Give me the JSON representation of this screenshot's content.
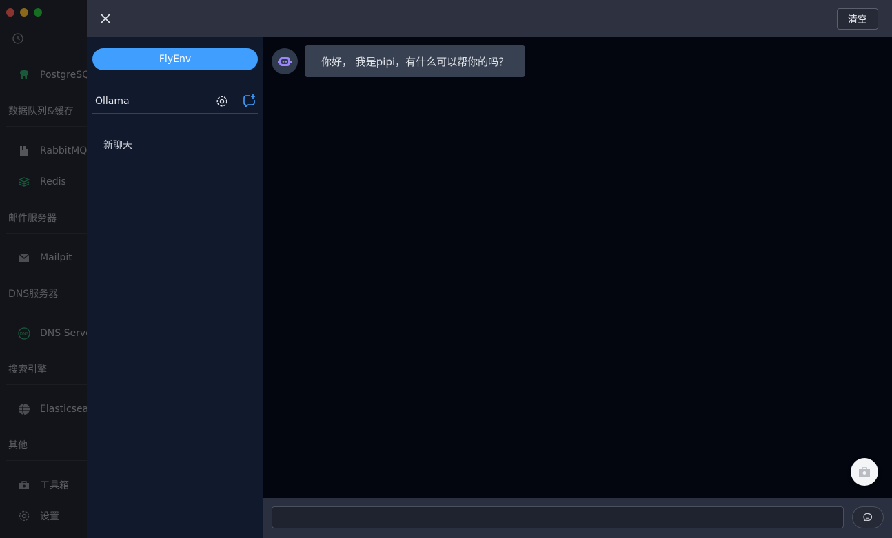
{
  "window": {
    "traffic_lights": [
      "close",
      "minimize",
      "maximize"
    ]
  },
  "background_sidebar": {
    "items": [
      {
        "label": "PostgreSQL",
        "icon": "elephant-icon"
      },
      {
        "label": "RabbitMQ",
        "icon": "rabbit-icon"
      },
      {
        "label": "Redis",
        "icon": "layers-icon"
      },
      {
        "label": "Mailpit",
        "icon": "mail-icon"
      },
      {
        "label": "DNS Server",
        "icon": "dns-icon"
      },
      {
        "label": "Elasticsearch",
        "icon": "globe-icon"
      },
      {
        "label": "工具箱",
        "icon": "toolbox-icon"
      },
      {
        "label": "设置",
        "icon": "gear-icon"
      }
    ],
    "sections": [
      "数据队列&缓存",
      "邮件服务器",
      "DNS服务器",
      "搜索引擎",
      "其他"
    ]
  },
  "drawer": {
    "clear_label": "清空",
    "app_button": "FlyEnv",
    "provider": "Ollama",
    "chats": [
      "新聊天"
    ],
    "message": "你好， 我是pipi，有什么可以帮你的吗？",
    "input": {
      "value": "",
      "placeholder": ""
    }
  },
  "colors": {
    "accent": "#409eff",
    "drawer_bg": "#03060f",
    "panel_bg": "#111a2d",
    "topbar_bg": "#2d3140"
  }
}
